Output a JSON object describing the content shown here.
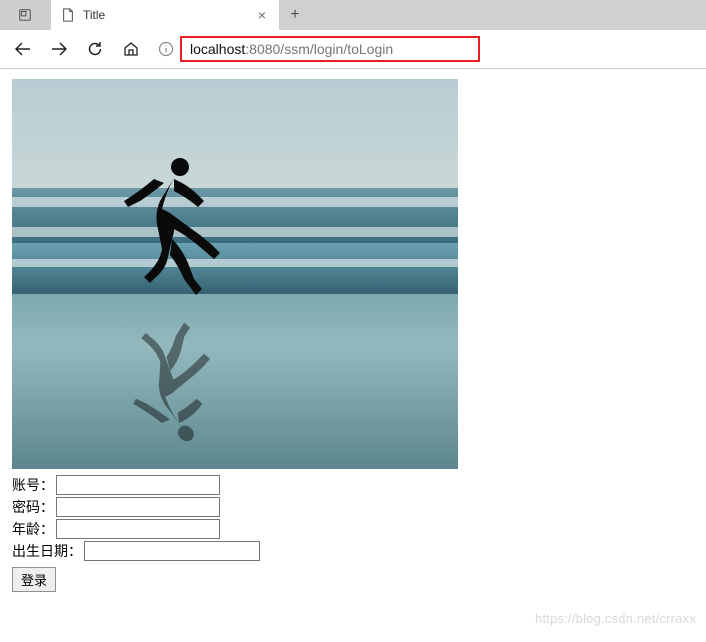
{
  "browser": {
    "tab_title": "Title",
    "close_glyph": "×",
    "new_tab_glyph": "+",
    "url_host": "localhost",
    "url_path": ":8080/ssm/login/toLogin"
  },
  "form": {
    "account_label": "账号：",
    "password_label": "密码：",
    "age_label": "年龄：",
    "birth_label": "出生日期：",
    "submit_label": "登录",
    "account_value": "",
    "password_value": "",
    "age_value": "",
    "birth_value": ""
  },
  "watermark": "https://blog.csdn.net/crraxx"
}
